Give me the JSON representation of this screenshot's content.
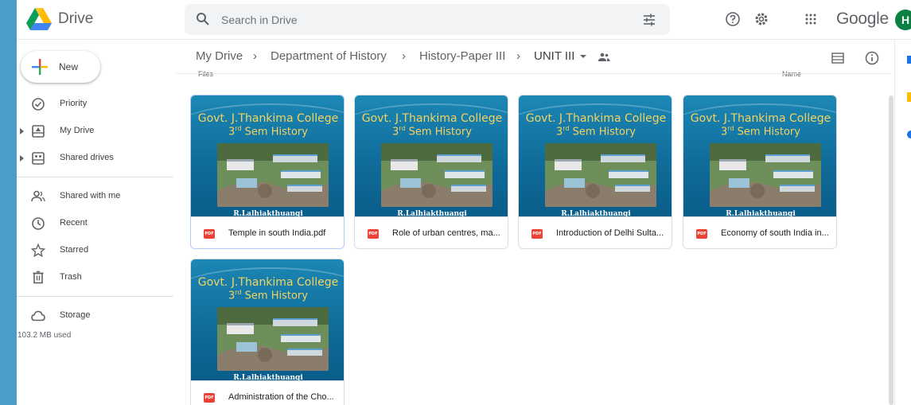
{
  "app": {
    "name": "Drive",
    "brand_word": "Google",
    "avatar_letter": "H"
  },
  "search": {
    "placeholder": "Search in Drive"
  },
  "sidebar": {
    "new_label": "New",
    "items": [
      {
        "label": "Priority",
        "icon": "priority-icon"
      },
      {
        "label": "My Drive",
        "icon": "my-drive-icon"
      },
      {
        "label": "Shared drives",
        "icon": "shared-drives-icon"
      },
      {
        "label": "Shared with me",
        "icon": "shared-with-me-icon"
      },
      {
        "label": "Recent",
        "icon": "clock-icon"
      },
      {
        "label": "Starred",
        "icon": "star-icon"
      },
      {
        "label": "Trash",
        "icon": "trash-icon"
      },
      {
        "label": "Storage",
        "icon": "cloud-icon"
      }
    ],
    "storage_used": "103.2 MB used"
  },
  "breadcrumb": [
    "My Drive",
    "Department of History",
    "History-Paper III",
    "UNIT III"
  ],
  "list_header": {
    "files_label": "Files",
    "sort_label": "Name"
  },
  "thumbnail": {
    "college": "Govt. J.Thankima College",
    "sem_num": "3",
    "sem_sup": "rd",
    "sem_rest": " Sem History",
    "author": "R.Lalhiakthuangi"
  },
  "files": [
    {
      "name": "Temple in south India.pdf",
      "type": "PDF"
    },
    {
      "name": "Role of urban centres, ma...",
      "type": "PDF"
    },
    {
      "name": "Introduction of Delhi Sulta...",
      "type": "PDF"
    },
    {
      "name": "Economy of south India in...",
      "type": "PDF"
    },
    {
      "name": "Administration of the Cho...",
      "type": "PDF"
    }
  ],
  "colors": {
    "accent": "#1a73e8",
    "pdf_red": "#ea4335",
    "background": "#4a9ccb",
    "thumb_title": "#f4d35e"
  }
}
